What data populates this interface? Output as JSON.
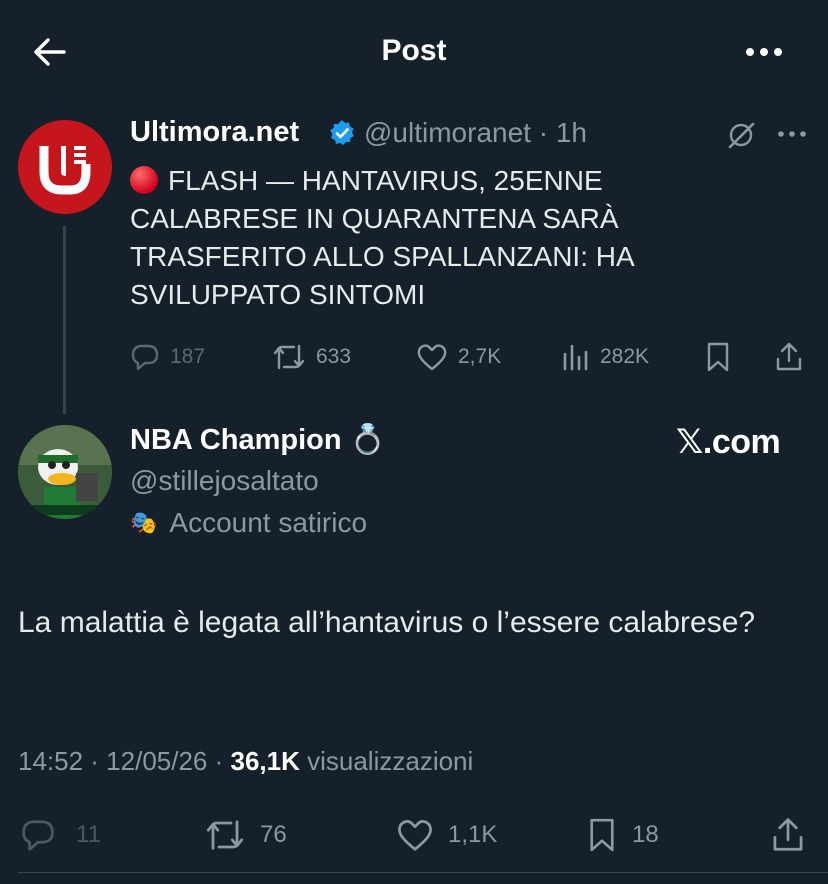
{
  "header": {
    "title": "Post"
  },
  "icons": {
    "back": "arrow-left-icon",
    "more": "more-horizontal-icon",
    "grok": "grok-icon",
    "verified": "verified-badge-icon"
  },
  "quoted_post": {
    "author_name": "Ultimora.net",
    "handle_time": "@ultimoranet · 1h",
    "text": "FLASH — HANTAVIRUS, 25ENNE CALABRESE IN QUARANTENA SARÀ TRASFERITO ALLO SPALLANZANI: HA SVILUPPATO SINTOMI",
    "stats": {
      "replies": "187",
      "reposts": "633",
      "likes": "2,7K",
      "views": "282K"
    }
  },
  "post": {
    "author_name": "NBA Champion",
    "author_emoji": "💍",
    "handle": "@stillejosaltato",
    "badge_emoji": "🎭",
    "badge_label": "Account satirico",
    "xcom_label": "𝕏.com",
    "text": "La malattia è legata all’hantavirus o l’essere calabrese?",
    "timestamp": "14:52 · 12/05/26 · ",
    "views_count": "36,1K",
    "views_label": "visualizzazioni",
    "stats": {
      "replies": "11",
      "reposts": "76",
      "likes": "1,1K",
      "bookmarks": "18"
    }
  },
  "colors": {
    "background": "#15202b",
    "accent": "#1d9bf0",
    "muted": "#8b98a5",
    "brand_red": "#c4161c"
  }
}
